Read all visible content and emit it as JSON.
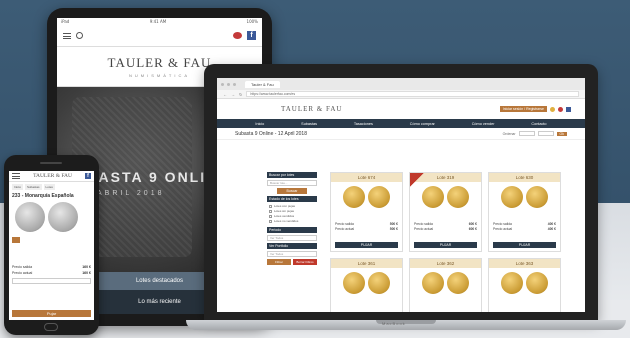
{
  "tablet": {
    "status_left": "iPad",
    "status_center": "9:41 AM",
    "status_right": "100%",
    "brand": "TAULER & FAU",
    "brand_sub": "NUMISMÁTICA",
    "hero_title": "SUBASTA 9 ONLI",
    "hero_date": "ABRIL 2018",
    "btn_featured": "Lotes destacados",
    "btn_recent": "Lo más reciente"
  },
  "laptop": {
    "tab_title": "Tauler & Fau",
    "url": "https://www.taulerfau.com/es",
    "brand": "TAULER & FAU",
    "register": "Iniciar sesión / Registrarse",
    "nav": [
      "Inicio",
      "Subastas",
      "Tasaciones",
      "Cómo comprar",
      "Cómo vender",
      "Contacto"
    ],
    "page_title": "Subasta 9 Online - 12 April 2018",
    "filter_label": "Ordenar",
    "ok": "Ok",
    "sidebar": {
      "search_head": "Buscar por lotes",
      "search_placeholder": "Buscar lote...",
      "search_btn": "Buscar",
      "state_head": "Estado de los lotes",
      "checks": [
        "Lotes con pujas",
        "Lotes sin pujas",
        "Lotes vendidos",
        "Lotes no vendidos"
      ],
      "periods_head": "Periodo",
      "periods_placeholder": "Ver Todos",
      "sub_head": "Ver Portfolio",
      "sub_placeholder": "Ver Todos",
      "btn_a": "Filtrar",
      "btn_b": "Borrar Filtros"
    },
    "cards": [
      {
        "lot": "Lote 674",
        "price_label": "Precio salida",
        "price": "500 €",
        "bid_label": "Precio actual",
        "bid": "500 €",
        "bid_btn": "PUJAR"
      },
      {
        "lot": "Lote 319",
        "price_label": "Precio salida",
        "price": "600 €",
        "bid_label": "Precio actual",
        "bid": "600 €",
        "bid_btn": "PUJAR"
      },
      {
        "lot": "Lote 630",
        "price_label": "Precio salida",
        "price": "400 €",
        "bid_label": "Precio actual",
        "bid": "400 €",
        "bid_btn": "PUJAR"
      }
    ],
    "cards_row2": [
      "Lote 361",
      "Lote 362",
      "Lote 363"
    ],
    "base_label": "MacBook"
  },
  "phone": {
    "brand": "TAULER & FAU",
    "tabs": [
      "Inicio",
      "Subastas",
      "Lotes"
    ],
    "lot_title": "233 - Monarquía Española",
    "price_label": "Precio salida",
    "price": "160 €",
    "bid_label": "Precio actual",
    "bid": "160 €",
    "bid_btn": "Pujar"
  }
}
